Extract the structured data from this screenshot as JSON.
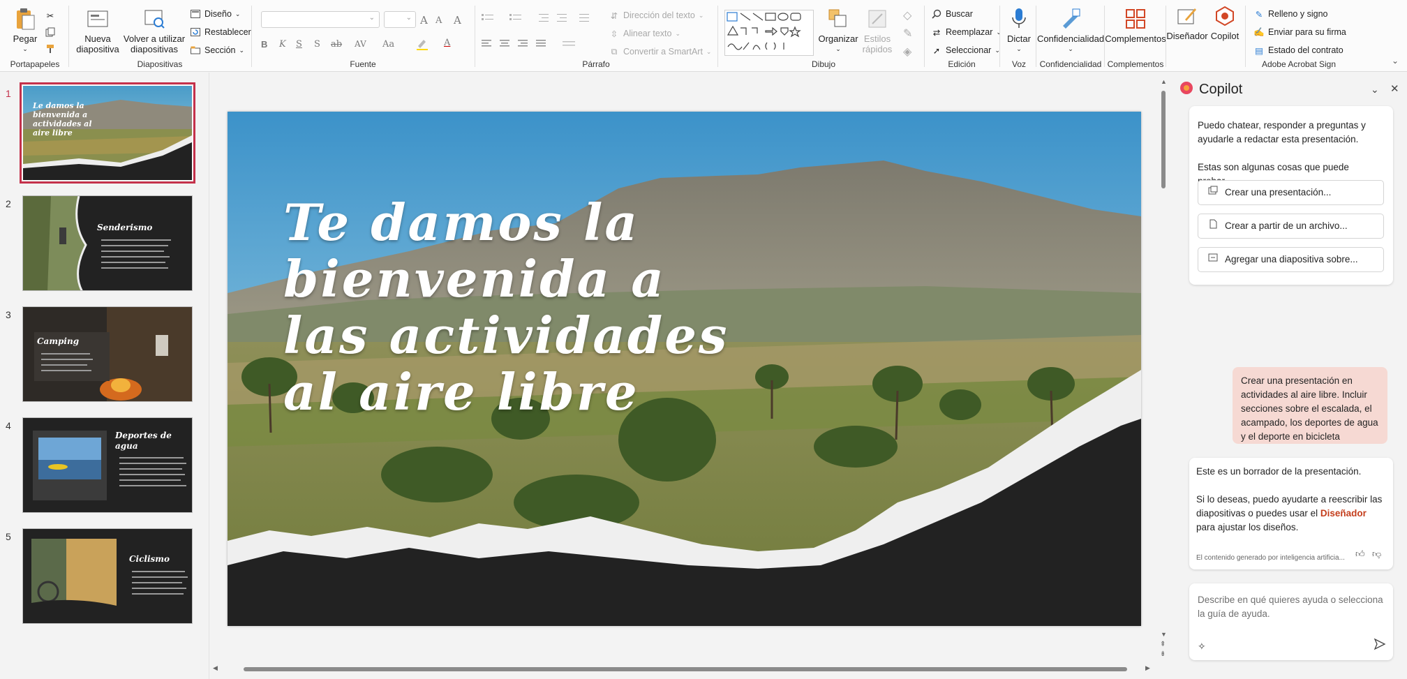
{
  "ribbon": {
    "portapapeles": {
      "group": "Portapapeles",
      "paste": "Pegar"
    },
    "diapositivas": {
      "group": "Diapositivas",
      "nueva": "Nueva diapositiva",
      "reuse": "Volver a utilizar diapositivas",
      "diseno": "Diseño",
      "restablecer": "Restablecer",
      "seccion": "Sección"
    },
    "fuente": {
      "group": "Fuente",
      "bold": "B",
      "italic": "K",
      "underline": "S",
      "shadow": "S",
      "strike": "ab",
      "spacing": "AV",
      "case": "Aa",
      "grow": "A",
      "shrink": "A",
      "clear": "A"
    },
    "parrafo": {
      "group": "Párrafo",
      "direccion": "Dirección del texto",
      "alinear": "Alinear texto",
      "smartart": "Convertir a SmartArt"
    },
    "dibujo": {
      "group": "Dibujo",
      "organizar": "Organizar",
      "estilos": "Estilos rápidos"
    },
    "edicion": {
      "group": "Edición",
      "buscar": "Buscar",
      "reemplazar": "Reemplazar",
      "seleccionar": "Seleccionar"
    },
    "voz": {
      "group": "Voz",
      "dictar": "Dictar"
    },
    "confidencialidad": {
      "group": "Confidencialidad",
      "btn": "Confidencialidad"
    },
    "complementos": {
      "group": "Complementos",
      "btn": "Complementos"
    },
    "designer": "Diseñador",
    "copilot": "Copilot",
    "acrobat": {
      "group": "Adobe Acrobat Sign",
      "relleno": "Relleno y signo",
      "enviar": "Enviar para su firma",
      "estado": "Estado del contrato"
    }
  },
  "thumbnails": [
    {
      "num": "1",
      "title": "Le damos la bienvenida a actividades al aire libre"
    },
    {
      "num": "2",
      "title": "Senderismo"
    },
    {
      "num": "3",
      "title": "Camping"
    },
    {
      "num": "4",
      "title": "Deportes de agua"
    },
    {
      "num": "5",
      "title": "Ciclismo"
    }
  ],
  "slide": {
    "title_lines": [
      "Te damos la",
      "bienvenida a",
      "las actividades",
      "al aire libre"
    ]
  },
  "copilot": {
    "title": "Copilot",
    "intro1": "Puedo chatear, responder a preguntas y ayudarle a redactar esta presentación.",
    "intro2": "Estas son algunas cosas que puede probar...",
    "suggestions": [
      "Crear una presentación...",
      "Crear a partir de un archivo...",
      "Agregar una diapositiva sobre..."
    ],
    "user_msg": "Crear una presentación en actividades al aire libre. Incluir secciones sobre el escalada, el acampado, los deportes de agua y el deporte en bicicleta",
    "reply1": "Este es un borrador de la presentación.",
    "reply2_a": "Si lo deseas, puedo ayudarte a reescribir las diapositivas o puedes usar el ",
    "reply2_link": "Diseñador",
    "reply2_b": " para ajustar los diseños.",
    "disclaimer": "El contenido generado por inteligencia artificia...",
    "input_placeholder": "Describe en qué quieres ayuda o selecciona la guía de ayuda."
  },
  "colors": {
    "accent": "#c4314b",
    "link": "#c43e1c",
    "user_bubble": "#f6d9d3"
  }
}
